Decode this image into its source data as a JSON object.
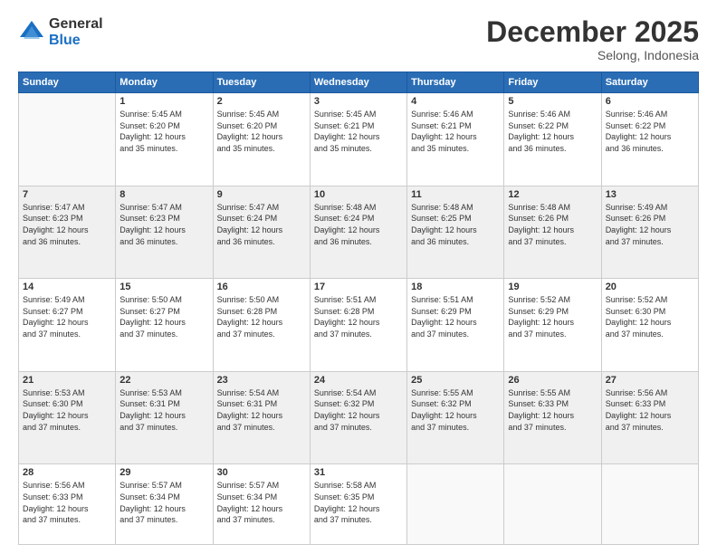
{
  "logo": {
    "general": "General",
    "blue": "Blue"
  },
  "header": {
    "month": "December 2025",
    "location": "Selong, Indonesia"
  },
  "weekdays": [
    "Sunday",
    "Monday",
    "Tuesday",
    "Wednesday",
    "Thursday",
    "Friday",
    "Saturday"
  ],
  "weeks": [
    [
      {
        "day": "",
        "sunrise": "",
        "sunset": "",
        "daylight": ""
      },
      {
        "day": "1",
        "sunrise": "Sunrise: 5:45 AM",
        "sunset": "Sunset: 6:20 PM",
        "daylight": "Daylight: 12 hours and 35 minutes."
      },
      {
        "day": "2",
        "sunrise": "Sunrise: 5:45 AM",
        "sunset": "Sunset: 6:20 PM",
        "daylight": "Daylight: 12 hours and 35 minutes."
      },
      {
        "day": "3",
        "sunrise": "Sunrise: 5:45 AM",
        "sunset": "Sunset: 6:21 PM",
        "daylight": "Daylight: 12 hours and 35 minutes."
      },
      {
        "day": "4",
        "sunrise": "Sunrise: 5:46 AM",
        "sunset": "Sunset: 6:21 PM",
        "daylight": "Daylight: 12 hours and 35 minutes."
      },
      {
        "day": "5",
        "sunrise": "Sunrise: 5:46 AM",
        "sunset": "Sunset: 6:22 PM",
        "daylight": "Daylight: 12 hours and 36 minutes."
      },
      {
        "day": "6",
        "sunrise": "Sunrise: 5:46 AM",
        "sunset": "Sunset: 6:22 PM",
        "daylight": "Daylight: 12 hours and 36 minutes."
      }
    ],
    [
      {
        "day": "7",
        "sunrise": "Sunrise: 5:47 AM",
        "sunset": "Sunset: 6:23 PM",
        "daylight": "Daylight: 12 hours and 36 minutes."
      },
      {
        "day": "8",
        "sunrise": "Sunrise: 5:47 AM",
        "sunset": "Sunset: 6:23 PM",
        "daylight": "Daylight: 12 hours and 36 minutes."
      },
      {
        "day": "9",
        "sunrise": "Sunrise: 5:47 AM",
        "sunset": "Sunset: 6:24 PM",
        "daylight": "Daylight: 12 hours and 36 minutes."
      },
      {
        "day": "10",
        "sunrise": "Sunrise: 5:48 AM",
        "sunset": "Sunset: 6:24 PM",
        "daylight": "Daylight: 12 hours and 36 minutes."
      },
      {
        "day": "11",
        "sunrise": "Sunrise: 5:48 AM",
        "sunset": "Sunset: 6:25 PM",
        "daylight": "Daylight: 12 hours and 36 minutes."
      },
      {
        "day": "12",
        "sunrise": "Sunrise: 5:48 AM",
        "sunset": "Sunset: 6:26 PM",
        "daylight": "Daylight: 12 hours and 37 minutes."
      },
      {
        "day": "13",
        "sunrise": "Sunrise: 5:49 AM",
        "sunset": "Sunset: 6:26 PM",
        "daylight": "Daylight: 12 hours and 37 minutes."
      }
    ],
    [
      {
        "day": "14",
        "sunrise": "Sunrise: 5:49 AM",
        "sunset": "Sunset: 6:27 PM",
        "daylight": "Daylight: 12 hours and 37 minutes."
      },
      {
        "day": "15",
        "sunrise": "Sunrise: 5:50 AM",
        "sunset": "Sunset: 6:27 PM",
        "daylight": "Daylight: 12 hours and 37 minutes."
      },
      {
        "day": "16",
        "sunrise": "Sunrise: 5:50 AM",
        "sunset": "Sunset: 6:28 PM",
        "daylight": "Daylight: 12 hours and 37 minutes."
      },
      {
        "day": "17",
        "sunrise": "Sunrise: 5:51 AM",
        "sunset": "Sunset: 6:28 PM",
        "daylight": "Daylight: 12 hours and 37 minutes."
      },
      {
        "day": "18",
        "sunrise": "Sunrise: 5:51 AM",
        "sunset": "Sunset: 6:29 PM",
        "daylight": "Daylight: 12 hours and 37 minutes."
      },
      {
        "day": "19",
        "sunrise": "Sunrise: 5:52 AM",
        "sunset": "Sunset: 6:29 PM",
        "daylight": "Daylight: 12 hours and 37 minutes."
      },
      {
        "day": "20",
        "sunrise": "Sunrise: 5:52 AM",
        "sunset": "Sunset: 6:30 PM",
        "daylight": "Daylight: 12 hours and 37 minutes."
      }
    ],
    [
      {
        "day": "21",
        "sunrise": "Sunrise: 5:53 AM",
        "sunset": "Sunset: 6:30 PM",
        "daylight": "Daylight: 12 hours and 37 minutes."
      },
      {
        "day": "22",
        "sunrise": "Sunrise: 5:53 AM",
        "sunset": "Sunset: 6:31 PM",
        "daylight": "Daylight: 12 hours and 37 minutes."
      },
      {
        "day": "23",
        "sunrise": "Sunrise: 5:54 AM",
        "sunset": "Sunset: 6:31 PM",
        "daylight": "Daylight: 12 hours and 37 minutes."
      },
      {
        "day": "24",
        "sunrise": "Sunrise: 5:54 AM",
        "sunset": "Sunset: 6:32 PM",
        "daylight": "Daylight: 12 hours and 37 minutes."
      },
      {
        "day": "25",
        "sunrise": "Sunrise: 5:55 AM",
        "sunset": "Sunset: 6:32 PM",
        "daylight": "Daylight: 12 hours and 37 minutes."
      },
      {
        "day": "26",
        "sunrise": "Sunrise: 5:55 AM",
        "sunset": "Sunset: 6:33 PM",
        "daylight": "Daylight: 12 hours and 37 minutes."
      },
      {
        "day": "27",
        "sunrise": "Sunrise: 5:56 AM",
        "sunset": "Sunset: 6:33 PM",
        "daylight": "Daylight: 12 hours and 37 minutes."
      }
    ],
    [
      {
        "day": "28",
        "sunrise": "Sunrise: 5:56 AM",
        "sunset": "Sunset: 6:33 PM",
        "daylight": "Daylight: 12 hours and 37 minutes."
      },
      {
        "day": "29",
        "sunrise": "Sunrise: 5:57 AM",
        "sunset": "Sunset: 6:34 PM",
        "daylight": "Daylight: 12 hours and 37 minutes."
      },
      {
        "day": "30",
        "sunrise": "Sunrise: 5:57 AM",
        "sunset": "Sunset: 6:34 PM",
        "daylight": "Daylight: 12 hours and 37 minutes."
      },
      {
        "day": "31",
        "sunrise": "Sunrise: 5:58 AM",
        "sunset": "Sunset: 6:35 PM",
        "daylight": "Daylight: 12 hours and 37 minutes."
      },
      {
        "day": "",
        "sunrise": "",
        "sunset": "",
        "daylight": ""
      },
      {
        "day": "",
        "sunrise": "",
        "sunset": "",
        "daylight": ""
      },
      {
        "day": "",
        "sunrise": "",
        "sunset": "",
        "daylight": ""
      }
    ]
  ]
}
